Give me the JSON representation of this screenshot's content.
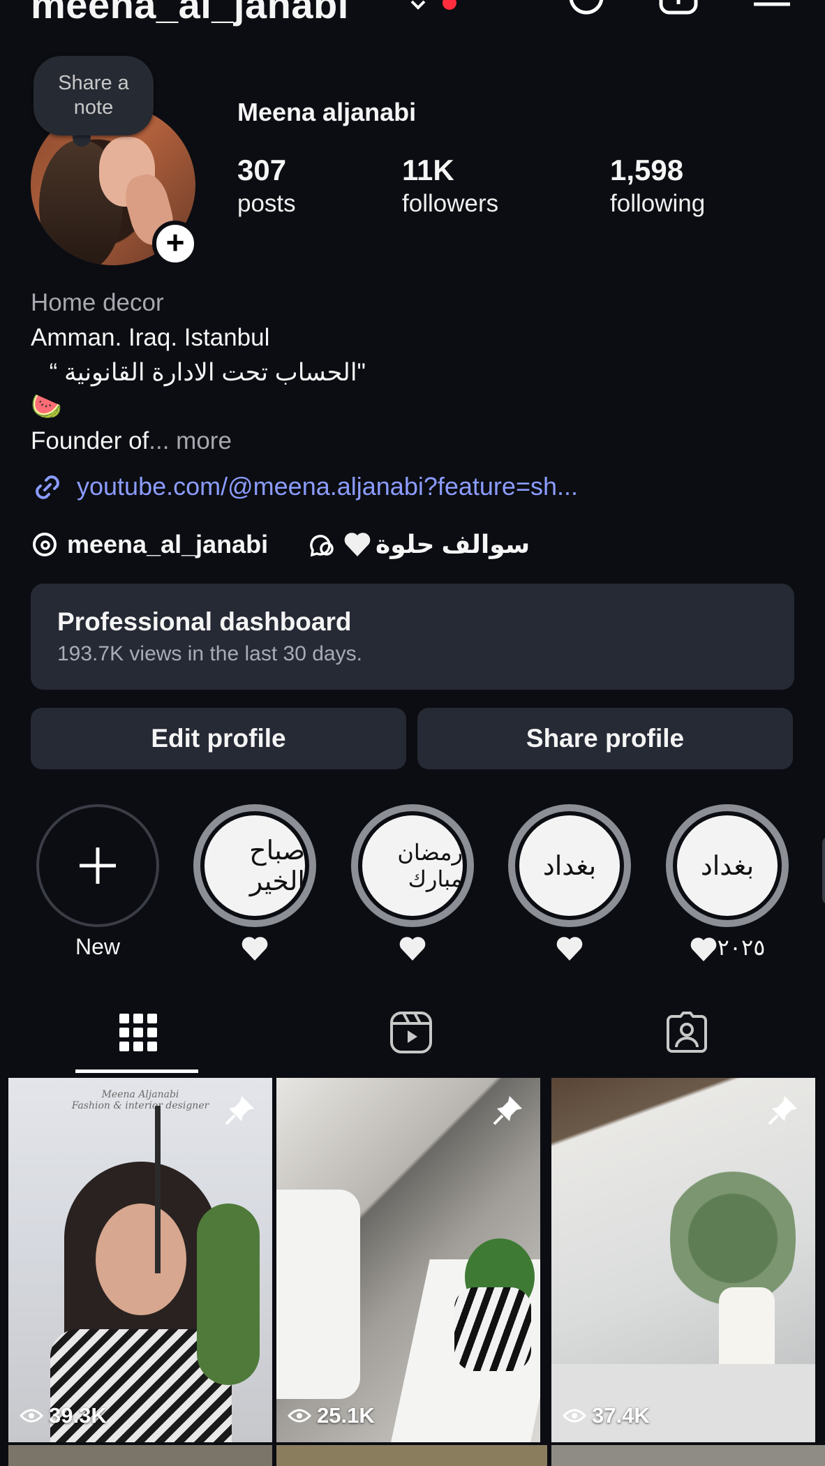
{
  "header": {
    "username": "meena_al_janabi"
  },
  "profile": {
    "note": "Share a note",
    "full_name": "Meena aljanabi",
    "stats": [
      {
        "value": "307",
        "label": "posts"
      },
      {
        "value": "11K",
        "label": "followers"
      },
      {
        "value": "1,598",
        "label": "following"
      }
    ],
    "bio": {
      "category": "Home decor",
      "line2": "Amman. Iraq. Istanbul",
      "line3": "\"الحساب تحت الادارة القانونية “",
      "emoji": "🍉",
      "line5": "Founder of",
      "more": "... more"
    },
    "link": "youtube.com/@meena.aljanabi?feature=sh...",
    "threads_handle": "meena_al_janabi",
    "threads_extra": "سوالف حلوة"
  },
  "dashboard": {
    "title": "Professional dashboard",
    "subtitle": "193.7K views in the last 30 days."
  },
  "buttons": {
    "edit": "Edit profile",
    "share": "Share profile"
  },
  "highlights": [
    {
      "label": "New"
    },
    {
      "cover": "صباح الخير",
      "label": ""
    },
    {
      "cover": "رمضان مبارك",
      "label": ""
    },
    {
      "cover": "بغداد",
      "label": ""
    },
    {
      "cover": "بغداد",
      "label": "٢٠٢٥"
    }
  ],
  "posts": [
    {
      "views": "39.3K",
      "caption": "Meena Aljanabi\nFashion & interior designer",
      "pinned": true
    },
    {
      "views": "25.1K",
      "pinned": true
    },
    {
      "views": "37.4K",
      "pinned": true
    }
  ]
}
